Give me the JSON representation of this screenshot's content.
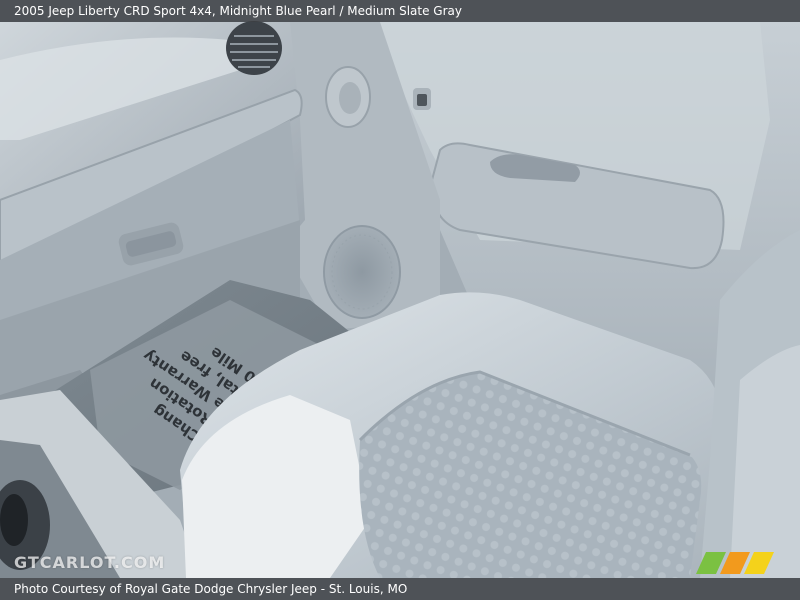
{
  "caption": {
    "title": "2005 Jeep Liberty CRD Sport 4x4,  Midnight Blue Pearl / Medium Slate Gray"
  },
  "credit": {
    "text": "Photo Courtesy of Royal Gate Dodge Chrysler Jeep - St. Louis, MO"
  },
  "watermark": {
    "text": "GTCARLOT.COM"
  },
  "floor_mat": {
    "lines": [
      "pe Oil Chang",
      "ve Tire Rotation",
      "3000 Mile Warranty",
      "ee Rental, free",
      "6000 Mile"
    ]
  },
  "colors": {
    "interior_gray": "#a9b3bb",
    "seat_light": "#c4ccd2",
    "stripe_green": "#7bc142",
    "stripe_orange": "#f29a1d",
    "stripe_yellow": "#f4d21b"
  },
  "icons": {
    "logo": "three-stripe-logo-icon",
    "vent": "air-vent-icon",
    "speaker": "speaker-grille-icon",
    "door_handle": "door-handle-icon",
    "lock": "door-lock-icon"
  }
}
